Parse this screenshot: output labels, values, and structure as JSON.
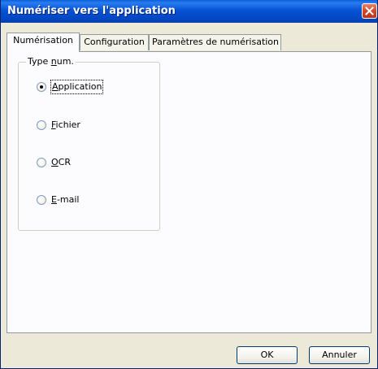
{
  "window": {
    "title": "Numériser vers l'application"
  },
  "tabs": [
    {
      "label": "Numérisation",
      "active": true
    },
    {
      "label": "Configuration",
      "active": false
    },
    {
      "label": "Paramètres de numérisation",
      "active": false
    }
  ],
  "scan_type": {
    "group_label_prefix": "Type ",
    "group_label_mnemonic": "n",
    "group_label_suffix": "um.",
    "options": [
      {
        "mnemonic": "A",
        "rest": "pplication",
        "selected": true
      },
      {
        "mnemonic": "F",
        "rest": "ichier",
        "selected": false
      },
      {
        "mnemonic": "O",
        "rest": "CR",
        "selected": false
      },
      {
        "mnemonic": "E",
        "rest": "-mail",
        "selected": false
      }
    ]
  },
  "buttons": {
    "ok_label": "OK",
    "cancel_label": "Annuler"
  },
  "icons": {
    "close": "close-icon"
  }
}
